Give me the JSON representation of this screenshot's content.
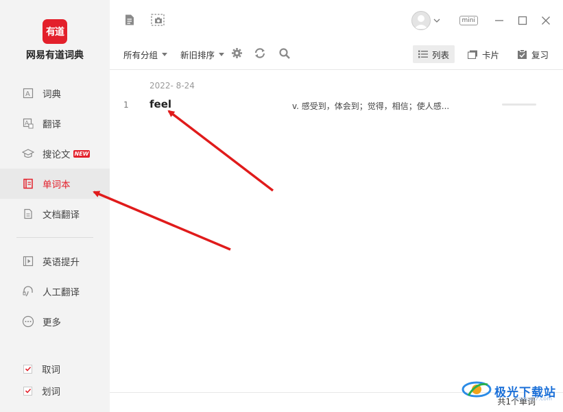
{
  "app": {
    "logo_text": "有道",
    "name": "网易有道词典"
  },
  "sidebar": {
    "items": [
      {
        "label": "词典",
        "icon": "dictionary-icon"
      },
      {
        "label": "翻译",
        "icon": "translate-icon"
      },
      {
        "label": "搜论文",
        "icon": "graduation-cap-icon",
        "badge": "NEW"
      },
      {
        "label": "单词本",
        "icon": "wordbook-icon",
        "active": true
      },
      {
        "label": "文档翻译",
        "icon": "document-icon"
      },
      {
        "label": "英语提升",
        "icon": "video-icon"
      },
      {
        "label": "人工翻译",
        "icon": "headset-icon"
      },
      {
        "label": "更多",
        "icon": "more-icon"
      }
    ],
    "checks": [
      {
        "label": "取词",
        "checked": true
      },
      {
        "label": "划词",
        "checked": true
      }
    ]
  },
  "header": {
    "mini_label": "mini"
  },
  "toolbar": {
    "group_filter": "所有分组",
    "sort_order": "新旧排序",
    "view_list": "列表",
    "view_card": "卡片",
    "review": "复习"
  },
  "wordlist": {
    "date": "2022- 8-24",
    "rows": [
      {
        "index": "1",
        "word": "feel",
        "definition": "v. 感受到，体会到；觉得，相信；使人感..."
      }
    ]
  },
  "footer": {
    "count_text": "共1个单词"
  },
  "watermark": {
    "text": "极光下载站",
    "url": "www.xz7.com"
  },
  "colors": {
    "accent": "#e3202b",
    "sidebar_bg": "#f3f3f3",
    "arrow": "#e01b1b"
  }
}
